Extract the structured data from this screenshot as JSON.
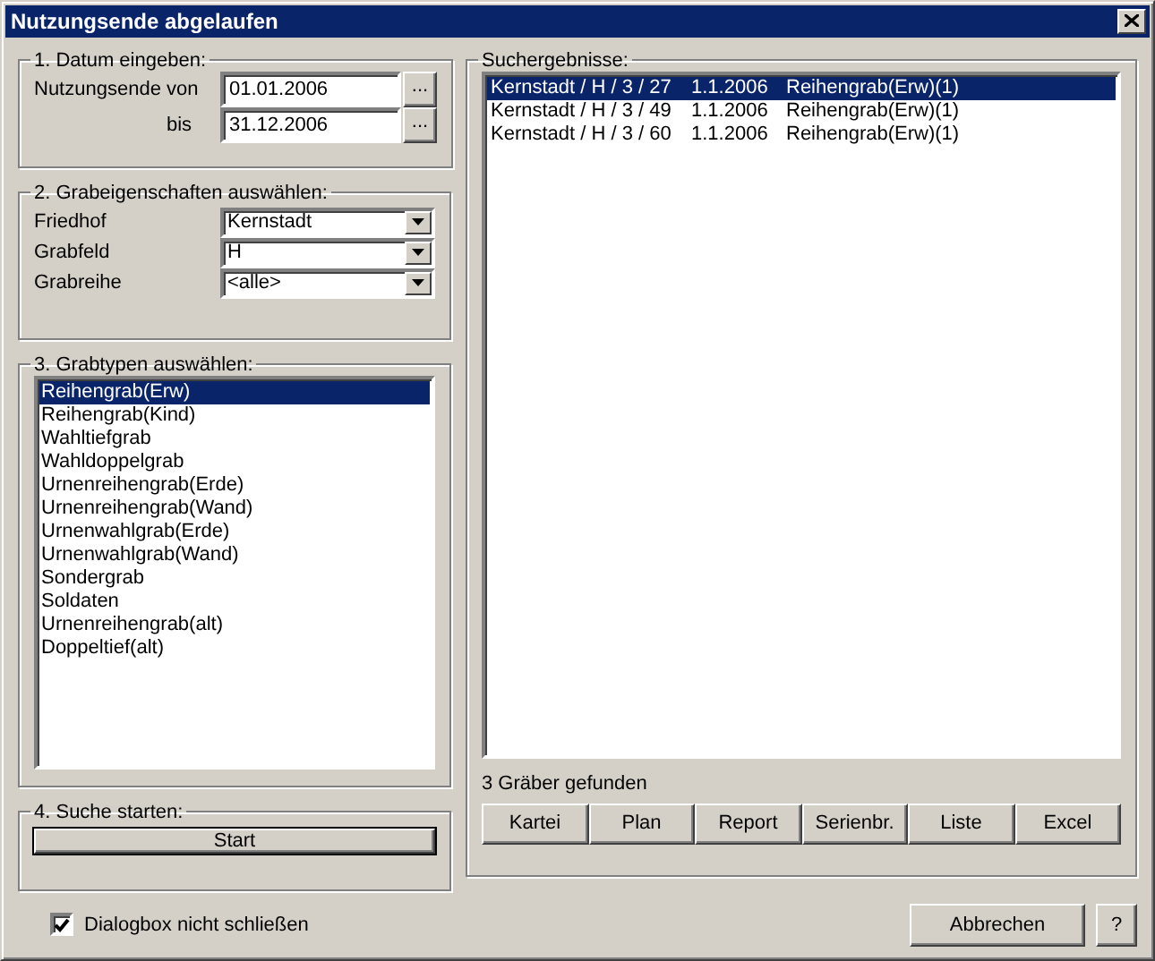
{
  "window": {
    "title": "Nutzungsende abgelaufen"
  },
  "date_group": {
    "title": "1. Datum eingeben:",
    "label": "Nutzungsende",
    "fields": [
      {
        "label": "von",
        "value": "01.01.2006",
        "button": "..."
      },
      {
        "label": "bis",
        "value": "31.12.2006",
        "button": "..."
      }
    ]
  },
  "properties_group": {
    "title": "2. Grabeigenschaften auswählen:",
    "fields": [
      {
        "label": "Friedhof",
        "value": "Kernstadt"
      },
      {
        "label": "Grabfeld",
        "value": "H"
      },
      {
        "label": "Grabreihe",
        "value": "<alle>"
      }
    ]
  },
  "types_group": {
    "title": "3. Grabtypen auswählen:",
    "items": [
      {
        "label": "Reihengrab(Erw)",
        "selected": true
      },
      {
        "label": "Reihengrab(Kind)",
        "selected": false
      },
      {
        "label": "Wahltiefgrab",
        "selected": false
      },
      {
        "label": "Wahldoppelgrab",
        "selected": false
      },
      {
        "label": "Urnenreihengrab(Erde)",
        "selected": false
      },
      {
        "label": "Urnenreihengrab(Wand)",
        "selected": false
      },
      {
        "label": "Urnenwahlgrab(Erde)",
        "selected": false
      },
      {
        "label": "Urnenwahlgrab(Wand)",
        "selected": false
      },
      {
        "label": "Sondergrab",
        "selected": false
      },
      {
        "label": "Soldaten",
        "selected": false
      },
      {
        "label": "Urnenreihengrab(alt)",
        "selected": false
      },
      {
        "label": "Doppeltief(alt)",
        "selected": false
      }
    ]
  },
  "search_group": {
    "title": "4. Suche starten:",
    "button": "Start"
  },
  "results": {
    "title": "Suchergebnisse:",
    "rows": [
      {
        "place": "Kernstadt / H / 3 / 27",
        "date": "1.1.2006",
        "type": "Reihengrab(Erw)(1)",
        "selected": true
      },
      {
        "place": "Kernstadt / H / 3 / 49",
        "date": "1.1.2006",
        "type": "Reihengrab(Erw)(1)",
        "selected": false
      },
      {
        "place": "Kernstadt / H / 3 / 60",
        "date": "1.1.2006",
        "type": "Reihengrab(Erw)(1)",
        "selected": false
      }
    ],
    "count": "3 Gräber gefunden",
    "buttons": [
      "Kartei",
      "Plan",
      "Report",
      "Serienbr.",
      "Liste",
      "Excel"
    ]
  },
  "footer": {
    "checkbox": {
      "label": "Dialogbox nicht schließen",
      "checked": true
    },
    "cancel": "Abbrechen",
    "help": "?"
  }
}
